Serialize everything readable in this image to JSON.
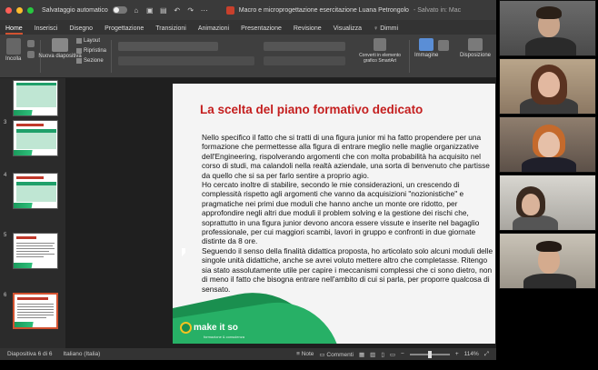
{
  "titlebar": {
    "autosave_label": "Salvataggio automatico",
    "document_title": "Macro e microprogettazione esercitazione Luana Petrongolo",
    "saved_status": "- Salvato in: Mac"
  },
  "tabs": [
    "Home",
    "Inserisci",
    "Disegno",
    "Progettazione",
    "Transizioni",
    "Animazioni",
    "Presentazione",
    "Revisione",
    "Visualizza",
    "Dimmi"
  ],
  "ribbon": {
    "incolla": "Incolla",
    "nuova_diapositiva": "Nuova diapositiva",
    "layout": "Layout",
    "ripristina": "Ripristina",
    "sezione": "Sezione",
    "converti": "Converti in elemento grafico SmartArt",
    "immagine": "Immagine",
    "disposizione": "Disposizione"
  },
  "thumbnails": [
    {
      "num": "",
      "title_text": ""
    },
    {
      "num": "3",
      "title_text": "Macroprogettazione del modulo di Processo"
    },
    {
      "num": "4",
      "title_text": "Microprogettazione del modulo di Processo"
    },
    {
      "num": "5",
      "title_text": "La scelta del contenuto"
    },
    {
      "num": "6",
      "title_text": "La scelta del piano formativo dedicato"
    }
  ],
  "slide": {
    "title": "La scelta del piano formativo dedicato",
    "paragraphs": [
      "Nello specifico il fatto che si tratti di una figura junior mi ha fatto propendere per una formazione che permettesse alla figura di entrare meglio nelle maglie organizzative dell'Engineering, rispolverando argomenti che con molta probabilità ha acquisito nel corso di studi, ma calandoli nella realtà aziendale, una sorta di benvenuto che partisse da quello che si sa per farlo sentire a proprio agio.",
      "Ho cercato inoltre di stabilire, secondo le mie considerazioni, un crescendo di complessità rispetto agli argomenti che vanno da acquisizioni \"nozionistiche\" e pragmatiche nei primi due moduli che hanno anche un monte ore ridotto, per approfondire negli altri due moduli il problem solving e la gestione dei rischi che, soprattutto in una figura junior devono ancora essere vissute e inserite nel bagaglio professionale, per cui maggiori scambi, lavori in gruppo e confronti in due giornate distinte da 8 ore.",
      "Seguendo il senso della finalità didattica proposta, ho articolato solo alcuni moduli delle singole unità didattiche, anche se avrei voluto mettere altro che completasse. Ritengo sia stato assolutamente utile per capire i meccanismi complessi che ci sono dietro, non di meno il fatto che bisogna entrare nell'ambito di cui si parla, per proporre qualcosa di sensato."
    ],
    "logo_text": "make it so",
    "logo_sub": "formazione & consulenza"
  },
  "status": {
    "slide_counter": "Diapositiva 6 di 6",
    "language": "Italiano (Italia)",
    "notes": "Note",
    "comments": "Commenti",
    "zoom": "114%"
  },
  "colors": {
    "accent": "#d35230",
    "title_red": "#c41e1e",
    "brand_green": "#1a8f4f"
  }
}
